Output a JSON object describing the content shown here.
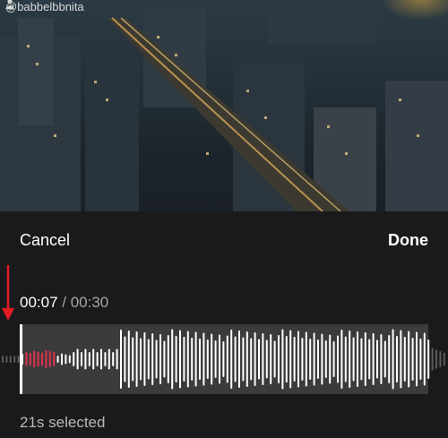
{
  "video": {
    "username": "@babbelbbnita"
  },
  "editor": {
    "cancel_label": "Cancel",
    "done_label": "Done",
    "current_time": "00:07",
    "separator": " / ",
    "total_time": "00:30",
    "selected_text": "21s selected"
  },
  "waveform": {
    "played_fraction": 0.23,
    "colors": {
      "played": "#e0324b",
      "unplayed": "#ffffff",
      "outside": "#5a5a5c",
      "window": "#3b3b3d",
      "arrow": "#e31b23"
    }
  },
  "icons": {
    "user": "user-icon",
    "arrow": "arrow-down-icon"
  }
}
